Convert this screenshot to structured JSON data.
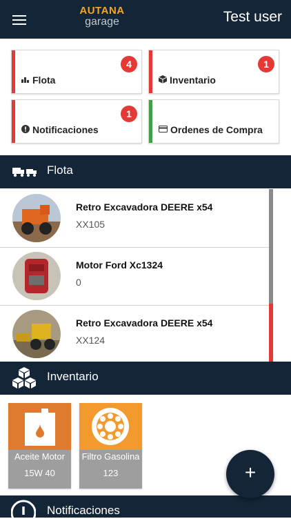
{
  "header": {
    "logo_line1": "AUTANA",
    "logo_line2": "garage",
    "user": "Test user"
  },
  "cards": [
    {
      "label": "Flota",
      "icon": "bar-chart-icon",
      "badge": "4",
      "accent": "#e53935"
    },
    {
      "label": "Inventario",
      "icon": "cube-icon",
      "badge": "1",
      "accent": "#e53935"
    },
    {
      "label": "Notificaciones",
      "icon": "alert-icon",
      "badge": "1",
      "accent": "#e53935"
    },
    {
      "label": "Ordenes de Compra",
      "icon": "credit-card-icon",
      "badge": "",
      "accent": "#43a047"
    }
  ],
  "sections": {
    "fleet": "Flota",
    "inventory": "Inventario",
    "notifications": "Notificaciones"
  },
  "fleet": [
    {
      "title": "Retro Excavadora DEERE x54",
      "subtitle": "XX105"
    },
    {
      "title": "Motor Ford Xc1324",
      "subtitle": "0"
    },
    {
      "title": "Retro Excavadora DEERE x54",
      "subtitle": "XX124"
    }
  ],
  "inventory": [
    {
      "name": "Aceite Motor",
      "value": "15W 40",
      "icon": "oil-can-icon",
      "color": "#e07a2e"
    },
    {
      "name": "Filtro Gasolina",
      "value": "123",
      "icon": "filter-icon",
      "color": "#f29a2e"
    }
  ],
  "fab": {
    "label": "+"
  },
  "colors": {
    "navy": "#132536",
    "red": "#e53935",
    "green": "#43a047"
  }
}
